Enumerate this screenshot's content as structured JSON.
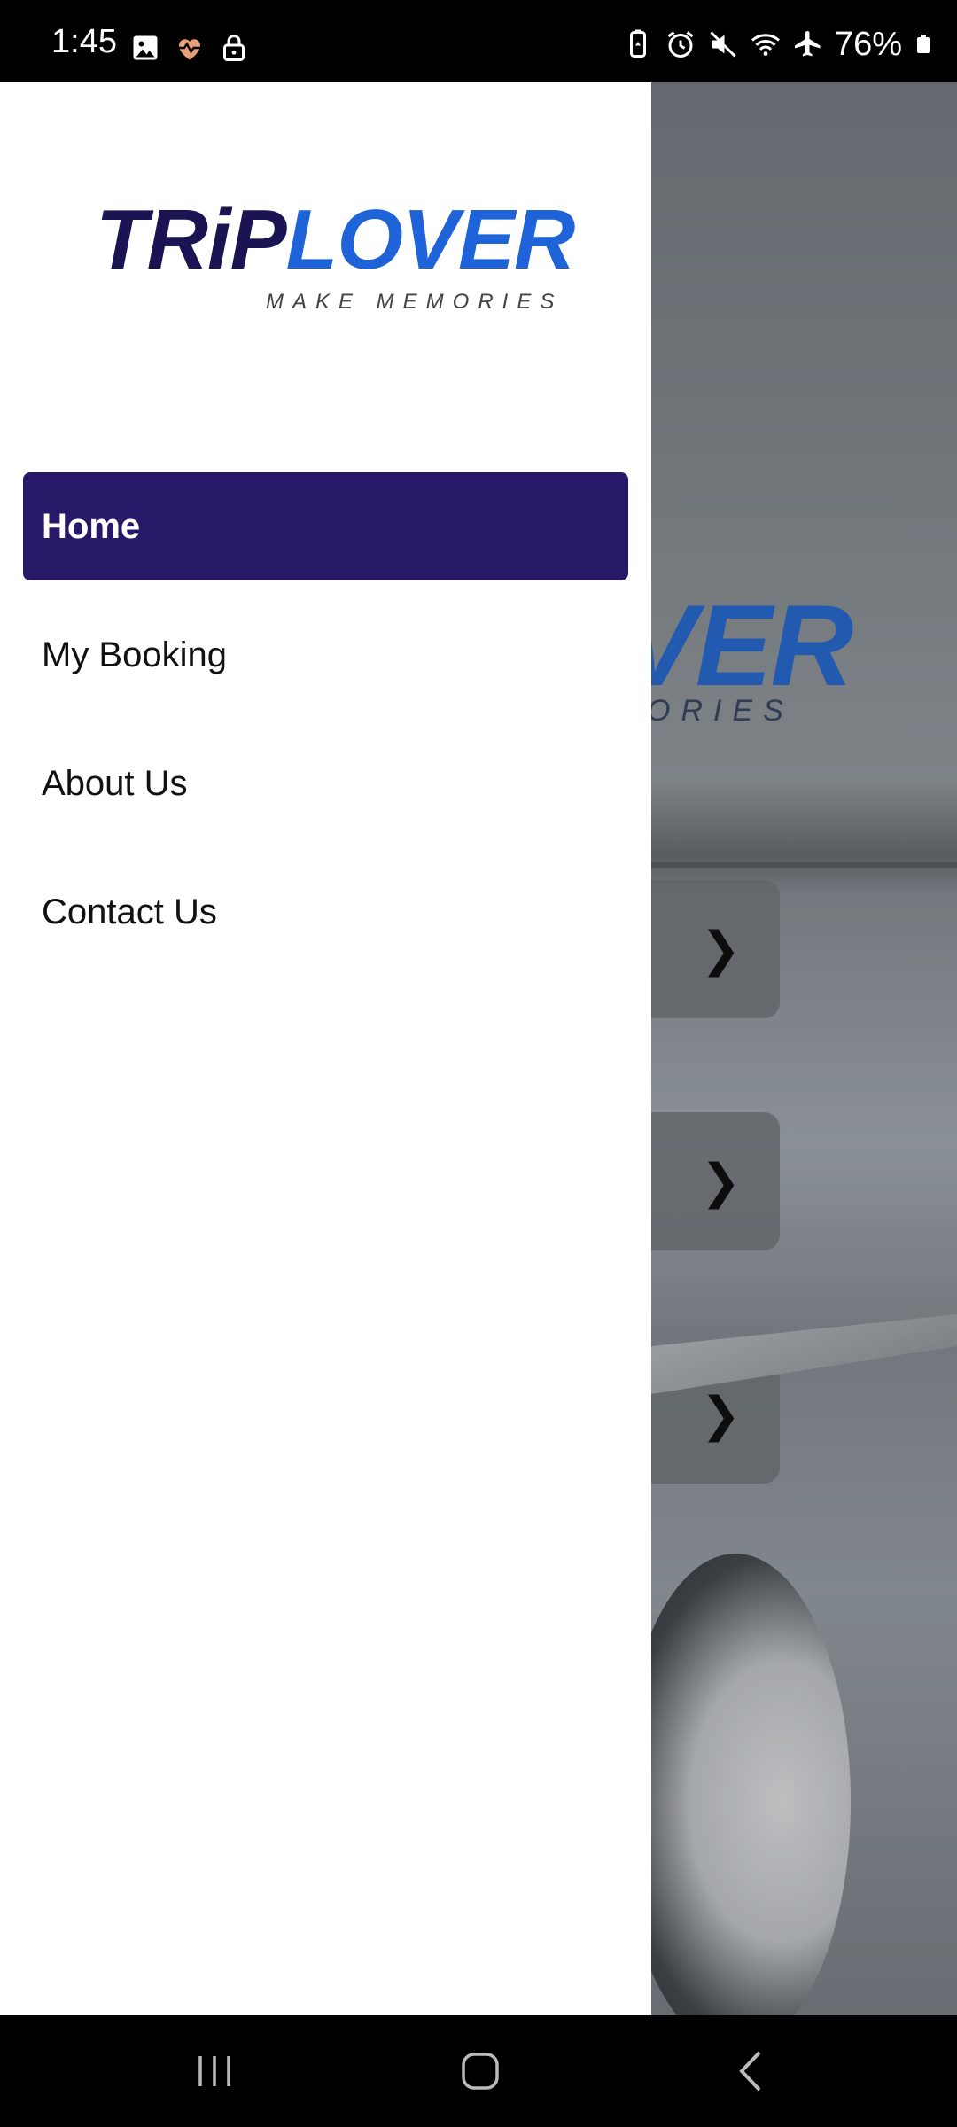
{
  "status_bar": {
    "time": "1:45",
    "left_icons": [
      "gallery-icon",
      "health-icon",
      "lock-icon"
    ],
    "right_icons": [
      "battery-saver-icon",
      "alarm-icon",
      "mute-icon",
      "wifi-icon",
      "airplane-icon"
    ],
    "battery_percent": "76%"
  },
  "drawer": {
    "logo": {
      "trip": "TRiP",
      "lover": "LOVER",
      "tagline": "MAKE MEMORIES"
    },
    "menu": [
      {
        "label": "Home",
        "active": true
      },
      {
        "label": "My Booking",
        "active": false
      },
      {
        "label": "About Us",
        "active": false
      },
      {
        "label": "Contact Us",
        "active": false
      }
    ]
  },
  "background": {
    "logo_fragment": "VER",
    "tagline_fragment": "ORIES"
  },
  "nav_bar": {
    "buttons": [
      "recent-apps-icon",
      "home-icon",
      "back-icon"
    ]
  },
  "colors": {
    "active_item": "#271868",
    "logo_dark": "#1a1552",
    "logo_blue": "#1e63d8"
  }
}
